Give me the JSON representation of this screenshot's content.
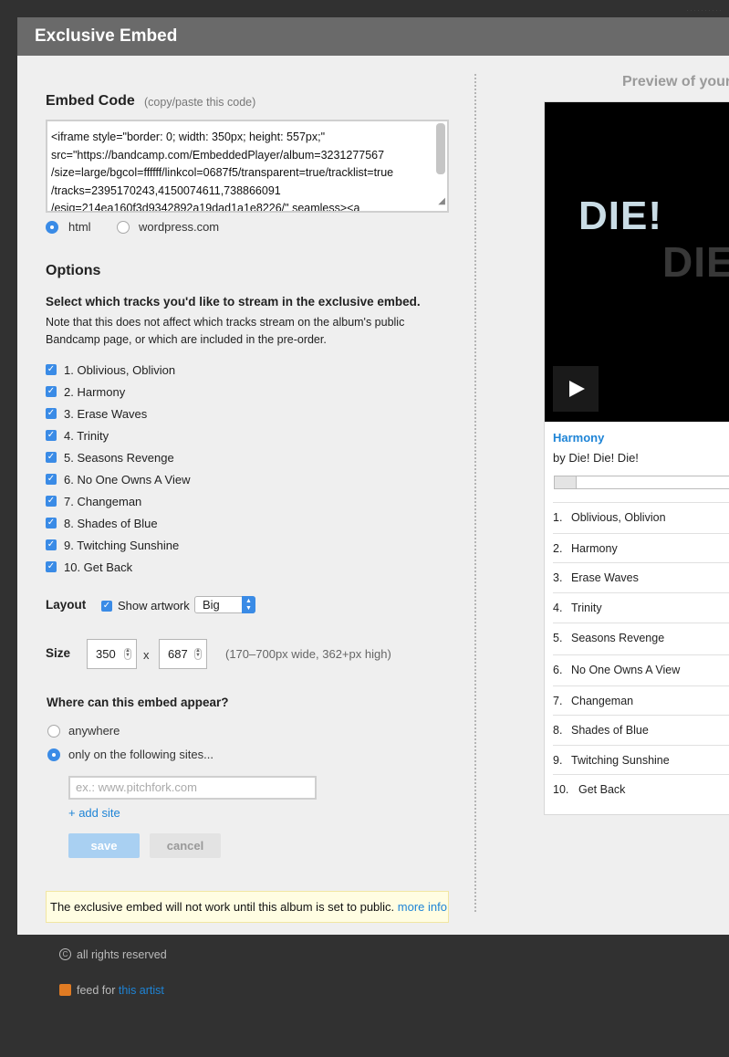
{
  "background": {
    "mark": "··········"
  },
  "dialog": {
    "title": "Exclusive Embed",
    "embed_code": {
      "heading": "Embed Code",
      "hint": "(copy/paste this code)",
      "lines": [
        "<iframe style=\"border: 0; width: 350px; height: 557px;\"",
        "src=\"https://bandcamp.com/EmbeddedPlayer/album=3231277567",
        "/size=large/bgcol=ffffff/linkcol=0687f5/transparent=true/tracklist=true",
        "/tracks=2395170243,4150074611,738866091",
        "/esig=214ea160f3d9342892a19dad1a1e8226/\" seamless><a"
      ],
      "format_options": [
        "html",
        "wordpress.com"
      ],
      "selected_format": "html"
    },
    "options": {
      "heading": "Options",
      "select_heading": "Select which tracks you'd like to stream in the exclusive embed.",
      "note": "Note that this does not affect which tracks stream on the album's public Bandcamp page, or which are included in the pre-order.",
      "tracks": [
        {
          "label": "1. Oblivious, Oblivion",
          "checked": true
        },
        {
          "label": "2. Harmony",
          "checked": true
        },
        {
          "label": "3. Erase Waves",
          "checked": true
        },
        {
          "label": "4. Trinity",
          "checked": true
        },
        {
          "label": "5. Seasons Revenge",
          "checked": true
        },
        {
          "label": "6. No One Owns A View",
          "checked": true
        },
        {
          "label": "7. Changeman",
          "checked": true
        },
        {
          "label": "8. Shades of Blue",
          "checked": true
        },
        {
          "label": "9. Twitching Sunshine",
          "checked": true
        },
        {
          "label": "10. Get Back",
          "checked": true
        }
      ]
    },
    "layout": {
      "label": "Layout",
      "show_artwork_label": "Show artwork",
      "show_artwork_checked": true,
      "artwork_size": "Big"
    },
    "size": {
      "label": "Size",
      "width": "350",
      "times": "x",
      "height": "687",
      "hint": "(170–700px wide, 362+px high)"
    },
    "placement": {
      "heading": "Where can this embed appear?",
      "options": [
        "anywhere",
        "only on the following sites..."
      ],
      "selected": "only on the following sites...",
      "site_placeholder": "ex.: www.pitchfork.com",
      "add_site": "+ add site",
      "save": "save",
      "cancel": "cancel"
    },
    "warning": {
      "text": "The exclusive embed will not work until this album is set to public.",
      "link": "more info"
    },
    "preview": {
      "title": "Preview of your",
      "art_text_1": "DIE!",
      "art_text_2": "DIE",
      "now_playing": "Harmony",
      "artist": "by Die! Die! Die!",
      "progress": 0.1,
      "playlist": [
        {
          "n": "1.",
          "title": "Oblivious, Oblivion"
        },
        {
          "n": "2.",
          "title": "Harmony"
        },
        {
          "n": "3.",
          "title": "Erase Waves"
        },
        {
          "n": "4.",
          "title": "Trinity"
        },
        {
          "n": "5.",
          "title": "Seasons Revenge"
        },
        {
          "n": "6.",
          "title": "No One Owns A View"
        },
        {
          "n": "7.",
          "title": "Changeman"
        },
        {
          "n": "8.",
          "title": "Shades of Blue"
        },
        {
          "n": "9.",
          "title": "Twitching Sunshine"
        },
        {
          "n": "10.",
          "title": "Get Back"
        }
      ]
    }
  },
  "footer": {
    "copyright": "all rights reserved",
    "feed_prefix": "feed for",
    "feed_link": "this artist"
  },
  "colors": {
    "accent": "#3a8be6",
    "link": "#1e84d6",
    "header": "#6a6a6a"
  }
}
